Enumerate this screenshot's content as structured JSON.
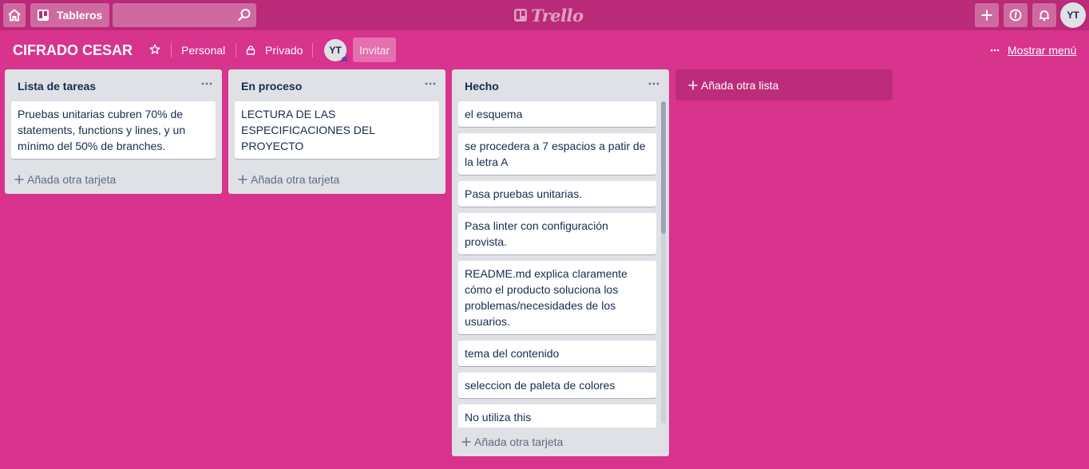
{
  "header": {
    "boards_label": "Tableros",
    "search_placeholder": "",
    "logo_text": "Trello",
    "avatar_initials": "YT"
  },
  "board": {
    "title": "CIFRADO CESAR",
    "team": "Personal",
    "visibility": "Privado",
    "member_initials": "YT",
    "invite_label": "Invitar",
    "show_menu_label": "Mostrar menú"
  },
  "lists": [
    {
      "title": "Lista de tareas",
      "cards": [
        "Pruebas unitarias cubren 70% de statements, functions y lines, y un mínimo del 50% de branches."
      ],
      "add_card_label": "Añada otra tarjeta"
    },
    {
      "title": "En proceso",
      "cards": [
        "LECTURA DE LAS ESPECIFICACIONES DEL PROYECTO"
      ],
      "add_card_label": "Añada otra tarjeta"
    },
    {
      "title": "Hecho",
      "cards": [
        "el esquema",
        "se procedera a 7 espacios a patir de la letra A",
        "Pasa pruebas unitarias.",
        "Pasa linter con configuración provista.",
        "README.md explica claramente cómo el producto soluciona los problemas/necesidades de los usuarios.",
        "tema del contenido",
        "seleccion de paleta de colores",
        "No utiliza this"
      ],
      "add_card_label": "Añada otra tarjeta"
    }
  ],
  "add_list_label": "Añada otra lista",
  "colors": {
    "board_background": "#d8338d",
    "header_background": "#ba2a78",
    "list_background": "#dfe1e6"
  }
}
